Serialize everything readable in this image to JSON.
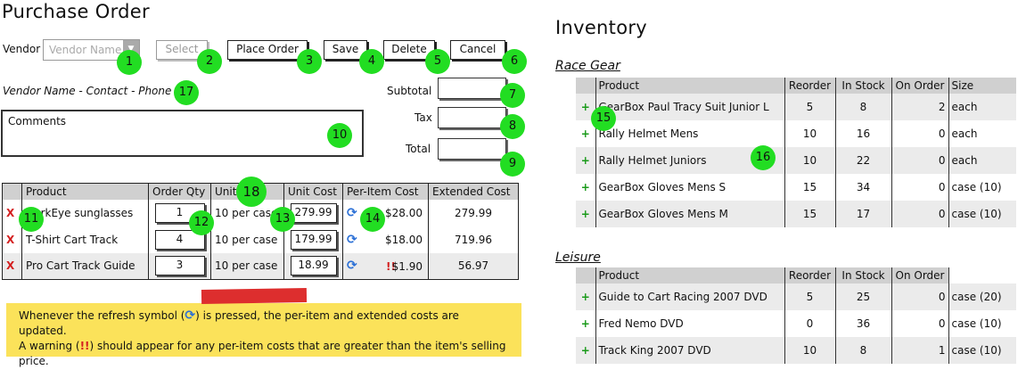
{
  "po": {
    "title": "Purchase Order",
    "vendor_label": "Vendor",
    "vendor_placeholder": "Vendor Name",
    "select_label": "Select",
    "place_order_label": "Place Order",
    "save_label": "Save",
    "delete_label": "Delete",
    "cancel_label": "Cancel",
    "vendor_info": "Vendor Name - Contact - Phone",
    "subtotal_label": "Subtotal",
    "tax_label": "Tax",
    "total_label": "Total",
    "comments_label": "Comments",
    "table": {
      "headers": [
        "Product",
        "Order Qty",
        "Unit",
        "Unit Cost",
        "Per-Item Cost",
        "Extended Cost"
      ],
      "rows": [
        {
          "product": "DarkEye sunglasses",
          "qty": "1",
          "unit": "10 per case",
          "unit_cost": "279.99",
          "per_item": "$28.00",
          "warning": "",
          "extended": "279.99"
        },
        {
          "product": "T-Shirt Cart Track",
          "qty": "4",
          "unit": "10 per case",
          "unit_cost": "179.99",
          "per_item": "$18.00",
          "warning": "",
          "extended": "719.96"
        },
        {
          "product": "Pro Cart Track Guide",
          "qty": "3",
          "unit": "10 per case",
          "unit_cost": "18.99",
          "per_item": "$1.90",
          "warning": "!!",
          "extended": "56.97"
        }
      ]
    },
    "note": {
      "part1": "Whenever the refresh symbol (",
      "part2": ") is pressed, the per-item and extended costs are updated.",
      "line2a": "A warning (",
      "line2b": "!!",
      "line2c": ") should appear for any per-item costs that are greater than the item's selling",
      "line3": "price."
    }
  },
  "inventory": {
    "title": "Inventory",
    "race_gear": {
      "title": "Race Gear",
      "headers": [
        "Product",
        "Reorder",
        "In Stock",
        "On Order",
        "Size"
      ],
      "rows": [
        {
          "product": "GearBox Paul Tracy Suit Junior L",
          "reorder": "5",
          "stock": "8",
          "order": "2",
          "size": "each"
        },
        {
          "product": "Rally Helmet Mens",
          "reorder": "10",
          "stock": "16",
          "order": "0",
          "size": "each"
        },
        {
          "product": "Rally Helmet Juniors",
          "reorder": "10",
          "stock": "22",
          "order": "0",
          "size": "each"
        },
        {
          "product": "GearBox Gloves Mens S",
          "reorder": "15",
          "stock": "34",
          "order": "0",
          "size": "case (10)"
        },
        {
          "product": "GearBox Gloves Mens M",
          "reorder": "15",
          "stock": "17",
          "order": "0",
          "size": "case (10)"
        }
      ]
    },
    "leisure": {
      "title": "Leisure",
      "headers": [
        "Product",
        "Reorder",
        "In Stock",
        "On Order",
        ""
      ],
      "rows": [
        {
          "product": "Guide to Cart Racing 2007 DVD",
          "reorder": "5",
          "stock": "25",
          "order": "0",
          "size": "case (20)"
        },
        {
          "product": "Fred Nemo DVD",
          "reorder": "0",
          "stock": "36",
          "order": "0",
          "size": "case (10)"
        },
        {
          "product": "Track King 2007 DVD",
          "reorder": "10",
          "stock": "8",
          "order": "1",
          "size": "case (10)"
        }
      ]
    }
  },
  "badges": [
    "1",
    "2",
    "3",
    "4",
    "5",
    "6",
    "7",
    "8",
    "9",
    "10",
    "11",
    "12",
    "13",
    "14",
    "15",
    "16",
    "17",
    "18"
  ],
  "colors": {
    "badge": "#22dd22",
    "note": "#fbe25a",
    "warning": "#d42020",
    "refresh": "#2a6fd6",
    "add": "#1a9a1a"
  }
}
